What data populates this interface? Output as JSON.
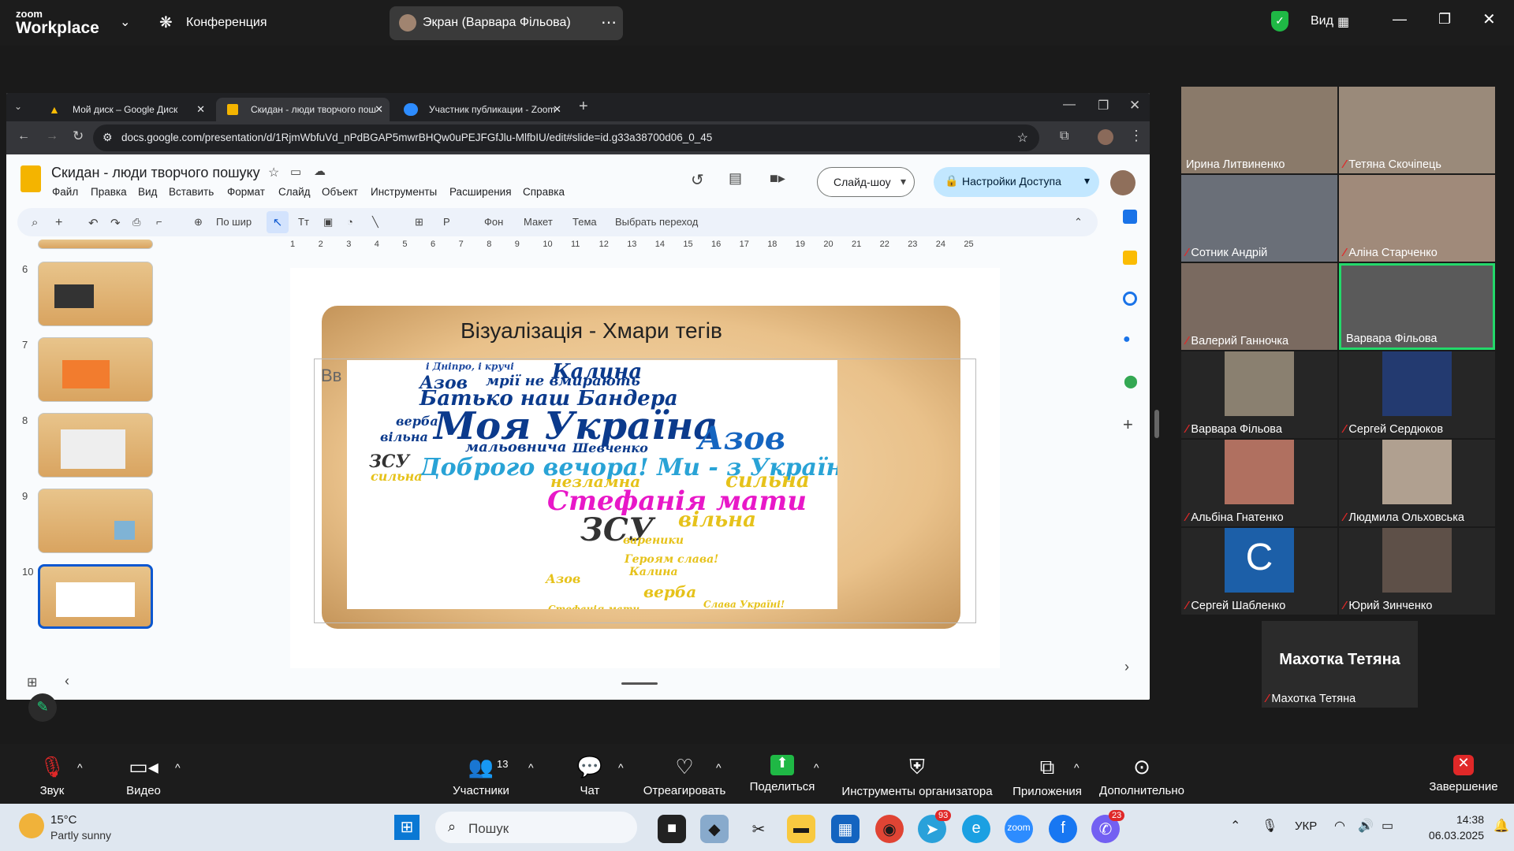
{
  "zoom": {
    "brand_top": "zoom",
    "brand_bottom": "Workplace",
    "conference": "Конференция",
    "share_pill": "Экран (Варвара Фільова)",
    "view": "Вид"
  },
  "chrome": {
    "tabs": [
      "Мой диск – Google Диск",
      "Скидан - люди творчого пош",
      "Участник публикации - Zoom"
    ],
    "url": "docs.google.com/presentation/d/1RjmWbfuVd_nPdBGAP5mwrBHQw0uPEJFGfJlu-MlfbIU/edit#slide=id.g33a38700d06_0_45"
  },
  "slides": {
    "title": "Скидан - люди творчого пошуку",
    "menu": [
      "Файл",
      "Правка",
      "Вид",
      "Вставить",
      "Формат",
      "Слайд",
      "Объект",
      "Инструменты",
      "Расширения",
      "Справка"
    ],
    "toolbar": {
      "zoom": "По шир",
      "bg": "Фон",
      "layout": "Макет",
      "theme": "Тема",
      "transition": "Выбрать переход"
    },
    "slideshow": "Слайд-шоу",
    "share": "Настройки Доступа",
    "thumb_numbers": [
      "6",
      "7",
      "8",
      "9",
      "10"
    ],
    "ruler": [
      "1",
      "2",
      "3",
      "4",
      "5",
      "6",
      "7",
      "8",
      "9",
      "10",
      "11",
      "12",
      "13",
      "14",
      "15",
      "16",
      "17",
      "18",
      "19",
      "20",
      "21",
      "22",
      "23",
      "24",
      "25"
    ],
    "slide_heading": "Візуалізація - Хмари тегів",
    "placeholder_fragment": "Вв",
    "words": [
      {
        "t": "Калина",
        "c": "#0b3a8c",
        "s": 26
      },
      {
        "t": "і Дніпро, і кручі",
        "c": "#1f4aa0",
        "s": 12
      },
      {
        "t": "Азов",
        "c": "#0b3a8c",
        "s": 22
      },
      {
        "t": "мрії не вмирають",
        "c": "#0b3a8c",
        "s": 18
      },
      {
        "t": "Батько наш Бандера",
        "c": "#0b3a8c",
        "s": 26
      },
      {
        "t": "верба",
        "c": "#0b3a8c",
        "s": 16
      },
      {
        "t": "Моя Україна",
        "c": "#0b3a8c",
        "s": 48
      },
      {
        "t": "Азов",
        "c": "#1565c0",
        "s": 40
      },
      {
        "t": "вільна",
        "c": "#0b3a8c",
        "s": 16
      },
      {
        "t": "мальовнича",
        "c": "#0b3a8c",
        "s": 18
      },
      {
        "t": "Шевченко",
        "c": "#0b3a8c",
        "s": 16
      },
      {
        "t": "ЗСУ",
        "c": "#333",
        "s": 22
      },
      {
        "t": "Доброго вечора! Ми - з України",
        "c": "#29a3d6",
        "s": 30
      },
      {
        "t": "сильна",
        "c": "#e6c21a",
        "s": 16
      },
      {
        "t": "незламна",
        "c": "#e6c21a",
        "s": 20
      },
      {
        "t": "сильна",
        "c": "#e6c21a",
        "s": 26
      },
      {
        "t": "Стефанія мати",
        "c": "#e818c8",
        "s": 34
      },
      {
        "t": "ЗСУ",
        "c": "#333",
        "s": 40
      },
      {
        "t": "вільна",
        "c": "#e6c21a",
        "s": 26
      },
      {
        "t": "вареники",
        "c": "#e6c21a",
        "s": 14
      },
      {
        "t": "Героям слава!",
        "c": "#e6c21a",
        "s": 14
      },
      {
        "t": "Калина",
        "c": "#e6c21a",
        "s": 14
      },
      {
        "t": "Азов",
        "c": "#e6c21a",
        "s": 16
      },
      {
        "t": "верба",
        "c": "#e6c21a",
        "s": 20
      },
      {
        "t": "Слава Україні!",
        "c": "#e6c21a",
        "s": 12
      },
      {
        "t": "Стефанія мати",
        "c": "#e6c21a",
        "s": 12
      }
    ]
  },
  "participants": [
    {
      "name": "Ирина Литвиненко",
      "muted": false
    },
    {
      "name": "Тетяна Скочіпець",
      "muted": true
    },
    {
      "name": "Сотник Андрій",
      "muted": true
    },
    {
      "name": "Аліна Старченко",
      "muted": true
    },
    {
      "name": "Валерий Ганночка",
      "muted": true
    },
    {
      "name": "Варвара Фільова",
      "muted": false
    },
    {
      "name": "Варвара Фільова",
      "muted": true
    },
    {
      "name": "Сергей Сердюков",
      "muted": true
    },
    {
      "name": "Альбіна Гнатенко",
      "muted": true
    },
    {
      "name": "Людмила Ольховська",
      "muted": true
    },
    {
      "name": "Сергей Шабленко",
      "muted": true
    },
    {
      "name": "Юрий Зинченко",
      "muted": true
    }
  ],
  "camera_off": {
    "big": "Махотка Тетяна",
    "small": "Махотка Тетяна"
  },
  "avatar_letter": "C",
  "controls": {
    "audio": "Звук",
    "video": "Видео",
    "participants": "Участники",
    "participants_count": "13",
    "chat": "Чат",
    "react": "Отреагировать",
    "share": "Поделиться",
    "host_tools": "Инструменты организатора",
    "apps": "Приложения",
    "more": "Дополнительно",
    "end": "Завершение"
  },
  "taskbar": {
    "temp": "15°C",
    "weather": "Partly sunny",
    "search": "Пошук",
    "lang": "УКР",
    "time": "14:38",
    "date": "06.03.2025",
    "badge_telegram": "93",
    "badge_viber": "23"
  }
}
